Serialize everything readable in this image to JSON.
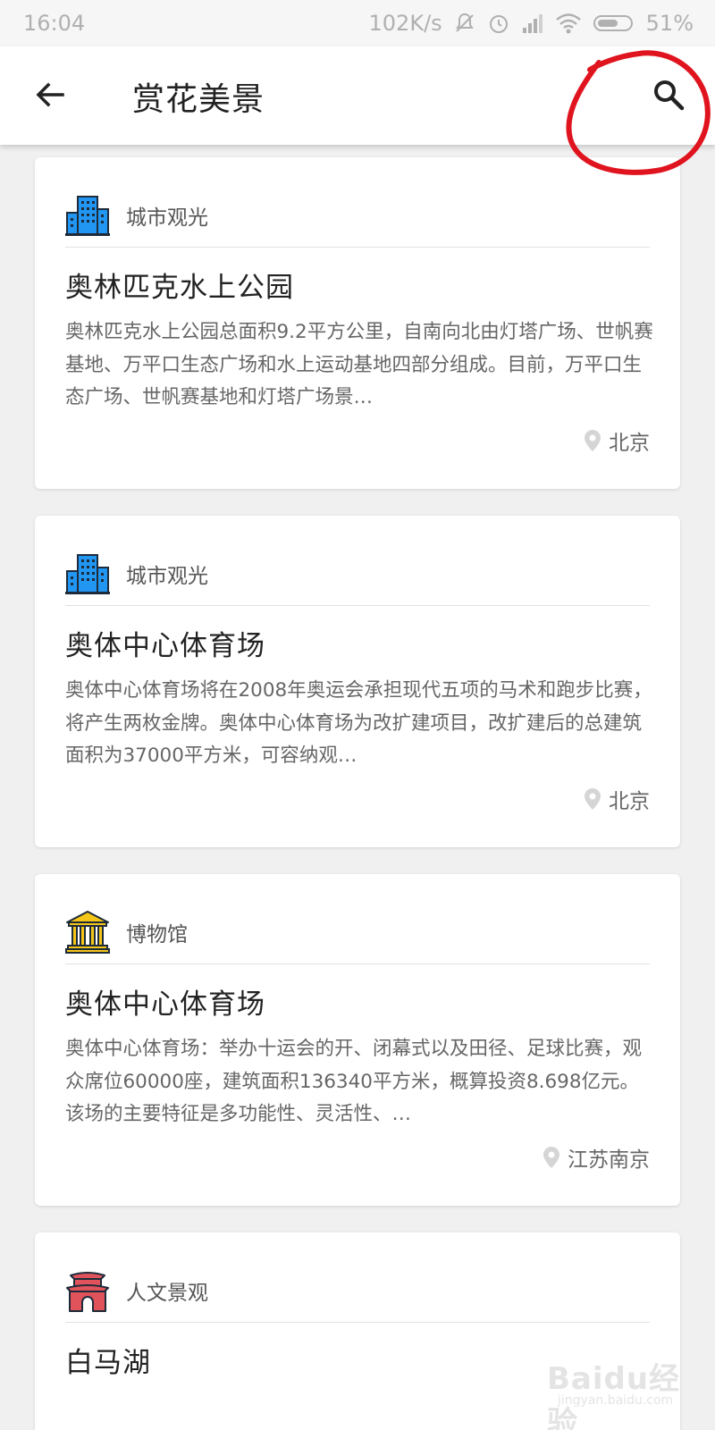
{
  "status_bar": {
    "time": "16:04",
    "network_speed": "102K/s",
    "battery": "51%",
    "icons": [
      "mute-bell-icon",
      "alarm-icon",
      "signal-icon",
      "wifi-icon",
      "battery-icon"
    ]
  },
  "app_bar": {
    "title": "赏花美景",
    "back_icon": "arrow-left-icon",
    "search_icon": "search-icon"
  },
  "annotation": {
    "color": "#e0141e",
    "shape": "hand-drawn-circle-around-search"
  },
  "cards": [
    {
      "category": "城市观光",
      "category_icon": "city-buildings-icon",
      "title": "奥林匹克水上公园",
      "description": "奥林匹克水上公园总面积9.2平方公里，自南向北由灯塔广场、世帆赛基地、万平口生态广场和水上运动基地四部分组成。目前，万平口生态广场、世帆赛基地和灯塔广场景…",
      "location": "北京"
    },
    {
      "category": "城市观光",
      "category_icon": "city-buildings-icon",
      "title": "奥体中心体育场",
      "description": "奥体中心体育场将在2008年奥运会承担现代五项的马术和跑步比赛，将产生两枚金牌。奥体中心体育场为改扩建项目，改扩建后的总建筑面积为37000平方米，可容纳观…",
      "location": "北京"
    },
    {
      "category": "博物馆",
      "category_icon": "museum-icon",
      "title": "奥体中心体育场",
      "description": "奥体中心体育场：举办十运会的开、闭幕式以及田径、足球比赛，观众席位60000座，建筑面积136340平方米，概算投资8.698亿元。该场的主要特征是多功能性、灵活性、…",
      "location": "江苏南京"
    },
    {
      "category": "人文景观",
      "category_icon": "gate-tower-icon",
      "title": "白马湖",
      "description": "",
      "location": ""
    }
  ],
  "watermark": {
    "main": "Baidu经验",
    "sub": "jingyan.baidu.com"
  },
  "colors": {
    "city_icon_blue": "#2196f3",
    "museum_icon_gold": "#f5c518",
    "gate_icon_red": "#e0535b",
    "background": "#f0f0f0"
  }
}
